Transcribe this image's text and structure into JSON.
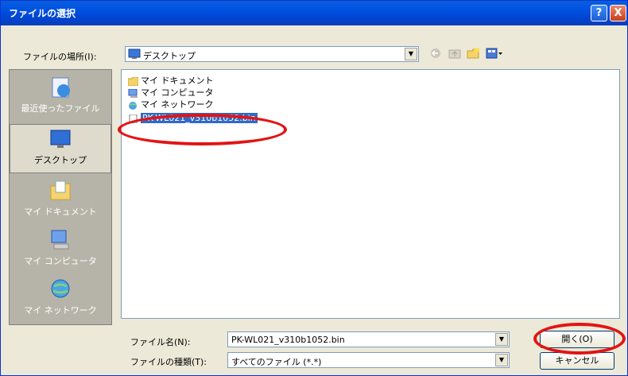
{
  "titlebar": {
    "title": "ファイルの選択",
    "help_label": "?",
    "close_label": "X"
  },
  "lookin": {
    "label": "ファイルの場所(I):",
    "value": "デスクトップ"
  },
  "places": [
    {
      "label": "最近使ったファイル",
      "icon": "recent-documents-icon"
    },
    {
      "label": "デスクトップ",
      "icon": "desktop-icon",
      "selected": true
    },
    {
      "label": "マイ ドキュメント",
      "icon": "my-documents-icon"
    },
    {
      "label": "マイ コンピュータ",
      "icon": "my-computer-icon"
    },
    {
      "label": "マイ ネットワーク",
      "icon": "my-network-icon"
    }
  ],
  "files": [
    {
      "name": "マイ ドキュメント",
      "icon": "folder-icon"
    },
    {
      "name": "マイ コンピュータ",
      "icon": "computer-icon"
    },
    {
      "name": "マイ ネットワーク",
      "icon": "network-icon"
    },
    {
      "name": "PK-WL021_v310b1052.bin",
      "icon": "file-icon",
      "selected": true
    }
  ],
  "filename": {
    "label": "ファイル名(N):",
    "value": "PK-WL021_v310b1052.bin"
  },
  "filetype": {
    "label": "ファイルの種類(T):",
    "value": "すべてのファイル (*.*)"
  },
  "buttons": {
    "open": "開く(O)",
    "cancel": "キャンセル"
  },
  "colors": {
    "titlebar": "#0054e3",
    "selection": "#316ac5",
    "highlight_ring": "#e21414"
  }
}
